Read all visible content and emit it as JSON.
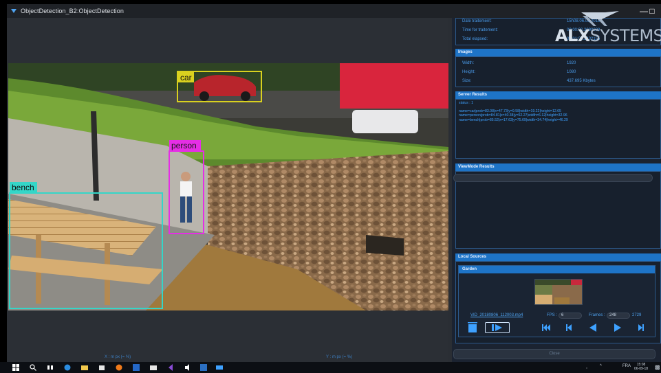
{
  "window": {
    "title": "ObjectDetection_B2:ObjectDetection",
    "minimize_label": "—",
    "maximize_label": "□"
  },
  "logo": {
    "mark": "ALX",
    "text": "SYSTEMS"
  },
  "stats": [
    {
      "label": "Date traitement:",
      "value": "15h08.06.09.2018"
    },
    {
      "label": "Time for traitement:",
      "value": "00:00:00.3990009"
    },
    {
      "label": "Total elapsed:",
      "value": "00:01:05.5432155"
    }
  ],
  "images": {
    "heading": "Images",
    "rows": [
      {
        "label": "Width:",
        "value": "1920"
      },
      {
        "label": "Height:",
        "value": "1080"
      },
      {
        "label": "Size:",
        "value": "437.695 Kbytes"
      }
    ]
  },
  "server_results": {
    "heading": "Server Results",
    "status": "status : 1",
    "lines": [
      "name=car|prob=83.08|x=47.73|y=9.58|width=19.22|height=12.65",
      "name=person|prob=84.81|x=40.38|y=52.27|width=6.12|height=32.96",
      "name=bench|prob=85.52|x=17.63|y=75.69|width=34.74|height=46.29"
    ]
  },
  "viewmode": {
    "heading": "ViewMode Results"
  },
  "local_sources": {
    "heading": "Local Sources",
    "garden": {
      "heading": "Garden",
      "filename": "VID_20180806_112003.mp4",
      "fps_label": "FPS :",
      "fps_value": "6",
      "frames_label": "Frames :",
      "frames_value": "248",
      "frames_total": "2729"
    }
  },
  "close_label": "Close",
  "video": {
    "detections": [
      {
        "label": "car",
        "color": "#d9d11f"
      },
      {
        "label": "person",
        "color": "#e52ee5"
      },
      {
        "label": "bench",
        "color": "#34d6c8"
      }
    ],
    "coord_x": "X : m px (= %)",
    "coord_y": "Y : m px (= %)"
  },
  "taskbar": {
    "tray_lang": "FRA",
    "time": "15:08",
    "date": "06-09-18",
    "icons": [
      "windows-start",
      "search",
      "task-view",
      "edge",
      "file-explorer",
      "store",
      "firefox",
      "bluetooth",
      "mail",
      "visual-studio",
      "sound",
      "settings",
      "app"
    ]
  },
  "colors": {
    "accent": "#1e74c7",
    "panel_bg": "#1b2331",
    "text_blue": "#4a9bea"
  }
}
